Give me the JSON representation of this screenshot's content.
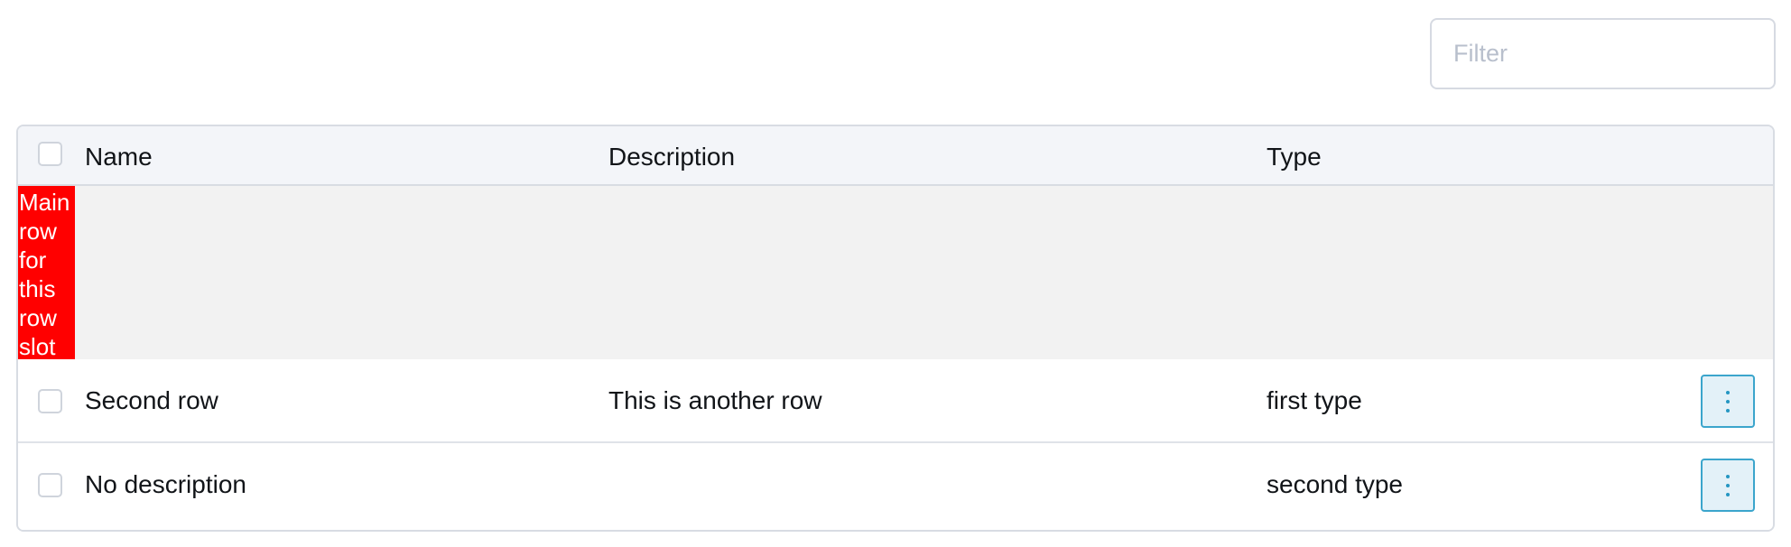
{
  "filter": {
    "placeholder": "Filter",
    "value": ""
  },
  "table": {
    "columns": {
      "name": "Name",
      "description": "Description",
      "type": "Type"
    },
    "slot_row": {
      "label": "Main row for this row slot"
    },
    "rows": [
      {
        "name": "Second row",
        "description": "This is another row",
        "type": "first type",
        "actions_icon": "kebab-vertical-icon"
      },
      {
        "name": "No description",
        "description": "",
        "type": "second type",
        "actions_icon": "kebab-vertical-icon"
      }
    ]
  },
  "colors": {
    "slot_highlight": "#ff0000",
    "slot_background": "#f2f2f2",
    "header_background": "#f3f5f9",
    "action_accent": "#2496c2"
  }
}
